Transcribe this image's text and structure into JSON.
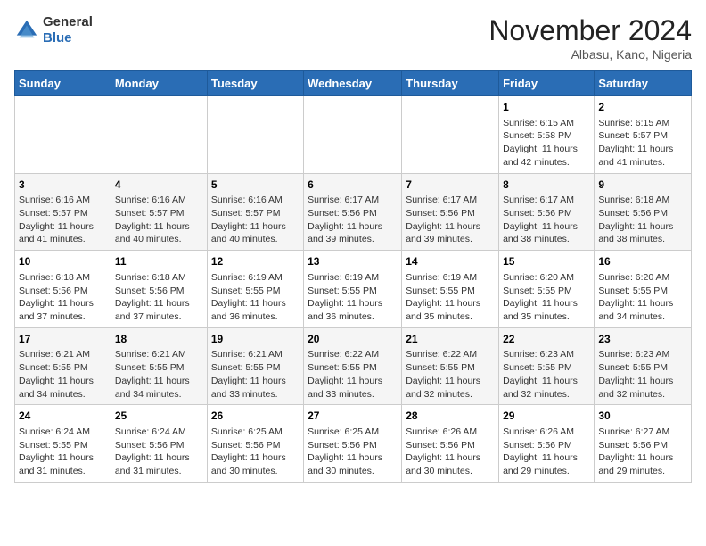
{
  "header": {
    "logo_general": "General",
    "logo_blue": "Blue",
    "month_title": "November 2024",
    "location": "Albasu, Kano, Nigeria"
  },
  "calendar": {
    "days_of_week": [
      "Sunday",
      "Monday",
      "Tuesday",
      "Wednesday",
      "Thursday",
      "Friday",
      "Saturday"
    ],
    "weeks": [
      [
        {
          "day": "",
          "info": ""
        },
        {
          "day": "",
          "info": ""
        },
        {
          "day": "",
          "info": ""
        },
        {
          "day": "",
          "info": ""
        },
        {
          "day": "",
          "info": ""
        },
        {
          "day": "1",
          "info": "Sunrise: 6:15 AM\nSunset: 5:58 PM\nDaylight: 11 hours\nand 42 minutes."
        },
        {
          "day": "2",
          "info": "Sunrise: 6:15 AM\nSunset: 5:57 PM\nDaylight: 11 hours\nand 41 minutes."
        }
      ],
      [
        {
          "day": "3",
          "info": "Sunrise: 6:16 AM\nSunset: 5:57 PM\nDaylight: 11 hours\nand 41 minutes."
        },
        {
          "day": "4",
          "info": "Sunrise: 6:16 AM\nSunset: 5:57 PM\nDaylight: 11 hours\nand 40 minutes."
        },
        {
          "day": "5",
          "info": "Sunrise: 6:16 AM\nSunset: 5:57 PM\nDaylight: 11 hours\nand 40 minutes."
        },
        {
          "day": "6",
          "info": "Sunrise: 6:17 AM\nSunset: 5:56 PM\nDaylight: 11 hours\nand 39 minutes."
        },
        {
          "day": "7",
          "info": "Sunrise: 6:17 AM\nSunset: 5:56 PM\nDaylight: 11 hours\nand 39 minutes."
        },
        {
          "day": "8",
          "info": "Sunrise: 6:17 AM\nSunset: 5:56 PM\nDaylight: 11 hours\nand 38 minutes."
        },
        {
          "day": "9",
          "info": "Sunrise: 6:18 AM\nSunset: 5:56 PM\nDaylight: 11 hours\nand 38 minutes."
        }
      ],
      [
        {
          "day": "10",
          "info": "Sunrise: 6:18 AM\nSunset: 5:56 PM\nDaylight: 11 hours\nand 37 minutes."
        },
        {
          "day": "11",
          "info": "Sunrise: 6:18 AM\nSunset: 5:56 PM\nDaylight: 11 hours\nand 37 minutes."
        },
        {
          "day": "12",
          "info": "Sunrise: 6:19 AM\nSunset: 5:55 PM\nDaylight: 11 hours\nand 36 minutes."
        },
        {
          "day": "13",
          "info": "Sunrise: 6:19 AM\nSunset: 5:55 PM\nDaylight: 11 hours\nand 36 minutes."
        },
        {
          "day": "14",
          "info": "Sunrise: 6:19 AM\nSunset: 5:55 PM\nDaylight: 11 hours\nand 35 minutes."
        },
        {
          "day": "15",
          "info": "Sunrise: 6:20 AM\nSunset: 5:55 PM\nDaylight: 11 hours\nand 35 minutes."
        },
        {
          "day": "16",
          "info": "Sunrise: 6:20 AM\nSunset: 5:55 PM\nDaylight: 11 hours\nand 34 minutes."
        }
      ],
      [
        {
          "day": "17",
          "info": "Sunrise: 6:21 AM\nSunset: 5:55 PM\nDaylight: 11 hours\nand 34 minutes."
        },
        {
          "day": "18",
          "info": "Sunrise: 6:21 AM\nSunset: 5:55 PM\nDaylight: 11 hours\nand 34 minutes."
        },
        {
          "day": "19",
          "info": "Sunrise: 6:21 AM\nSunset: 5:55 PM\nDaylight: 11 hours\nand 33 minutes."
        },
        {
          "day": "20",
          "info": "Sunrise: 6:22 AM\nSunset: 5:55 PM\nDaylight: 11 hours\nand 33 minutes."
        },
        {
          "day": "21",
          "info": "Sunrise: 6:22 AM\nSunset: 5:55 PM\nDaylight: 11 hours\nand 32 minutes."
        },
        {
          "day": "22",
          "info": "Sunrise: 6:23 AM\nSunset: 5:55 PM\nDaylight: 11 hours\nand 32 minutes."
        },
        {
          "day": "23",
          "info": "Sunrise: 6:23 AM\nSunset: 5:55 PM\nDaylight: 11 hours\nand 32 minutes."
        }
      ],
      [
        {
          "day": "24",
          "info": "Sunrise: 6:24 AM\nSunset: 5:55 PM\nDaylight: 11 hours\nand 31 minutes."
        },
        {
          "day": "25",
          "info": "Sunrise: 6:24 AM\nSunset: 5:56 PM\nDaylight: 11 hours\nand 31 minutes."
        },
        {
          "day": "26",
          "info": "Sunrise: 6:25 AM\nSunset: 5:56 PM\nDaylight: 11 hours\nand 30 minutes."
        },
        {
          "day": "27",
          "info": "Sunrise: 6:25 AM\nSunset: 5:56 PM\nDaylight: 11 hours\nand 30 minutes."
        },
        {
          "day": "28",
          "info": "Sunrise: 6:26 AM\nSunset: 5:56 PM\nDaylight: 11 hours\nand 30 minutes."
        },
        {
          "day": "29",
          "info": "Sunrise: 6:26 AM\nSunset: 5:56 PM\nDaylight: 11 hours\nand 29 minutes."
        },
        {
          "day": "30",
          "info": "Sunrise: 6:27 AM\nSunset: 5:56 PM\nDaylight: 11 hours\nand 29 minutes."
        }
      ]
    ]
  }
}
